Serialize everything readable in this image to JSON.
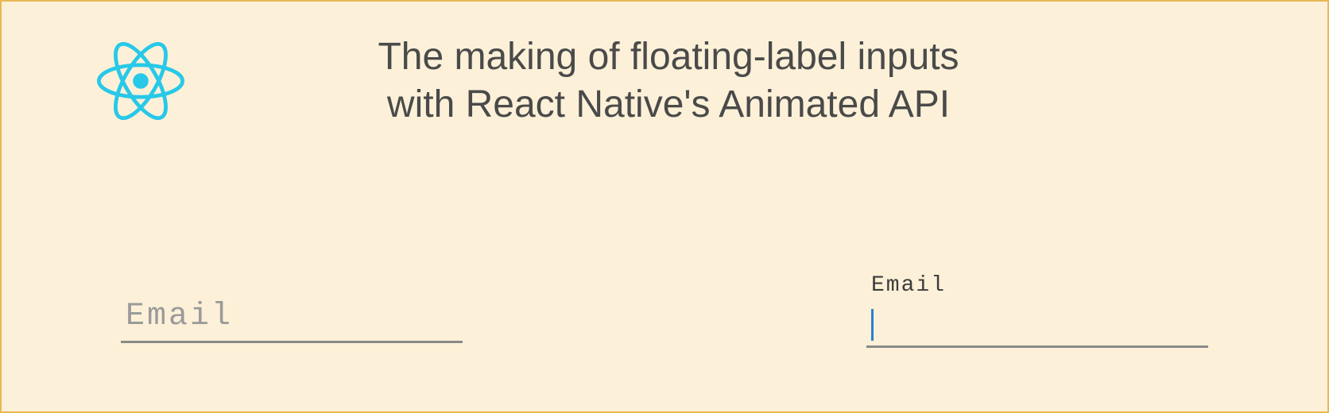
{
  "header": {
    "title_line1": "The making of floating-label inputs",
    "title_line2": "with React Native's Animated API"
  },
  "inputs": {
    "left": {
      "label": "Email"
    },
    "right": {
      "label": "Email"
    }
  },
  "colors": {
    "background": "#fcf1d8",
    "border": "#e8b854",
    "react_logo": "#28c8e8",
    "text": "#4a4a4a",
    "placeholder": "#9a9a9a",
    "underline": "#8a8a8a",
    "caret": "#2d7fcf"
  }
}
